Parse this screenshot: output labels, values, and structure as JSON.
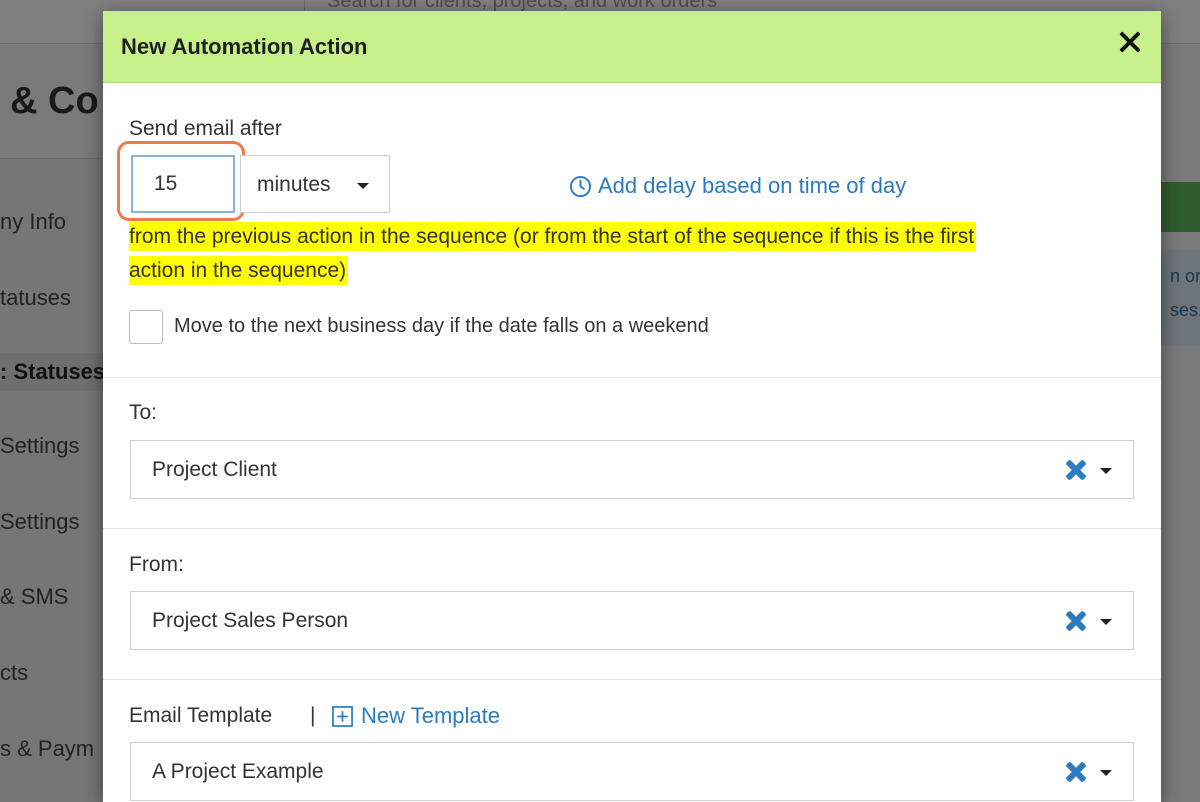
{
  "background": {
    "search_placeholder": "Search for clients, projects, and work orders",
    "page_heading": "& Co",
    "nav_items": [
      {
        "label": "ny Info"
      },
      {
        "label": "tatuses"
      },
      {
        "label": ": Statuses"
      },
      {
        "label": "Settings"
      },
      {
        "label": " Settings"
      },
      {
        "label": "& SMS"
      },
      {
        "label": "cts"
      },
      {
        "label": "s & Paym"
      }
    ],
    "info_lines": [
      "n org",
      "ses."
    ]
  },
  "modal": {
    "title": "New Automation Action",
    "send_email_after_label": "Send email after",
    "delay_value": "15",
    "delay_unit": "minutes",
    "time_of_day_link": "Add delay based on time of day",
    "sequence_note_line1": "from the previous action in the sequence (or from the start of the sequence if this is the first",
    "sequence_note_line2": "action in the sequence)",
    "weekend_checkbox_label": "Move to the next business day if the date falls on a weekend",
    "to_label": "To:",
    "to_value": "Project Client",
    "from_label": "From:",
    "from_value": "Project Sales Person",
    "template_label": "Email Template",
    "template_separator": "|",
    "new_template_link": "New Template",
    "template_value": "A Project Example"
  },
  "colors": {
    "header_bg": "#c6f08a",
    "link": "#2b7bc2",
    "highlight": "#ffff00",
    "focus_ring": "#f07b4a"
  },
  "icons": [
    "close-icon",
    "clock-icon",
    "clear-icon",
    "chevron-down-icon",
    "plus-square-icon"
  ]
}
